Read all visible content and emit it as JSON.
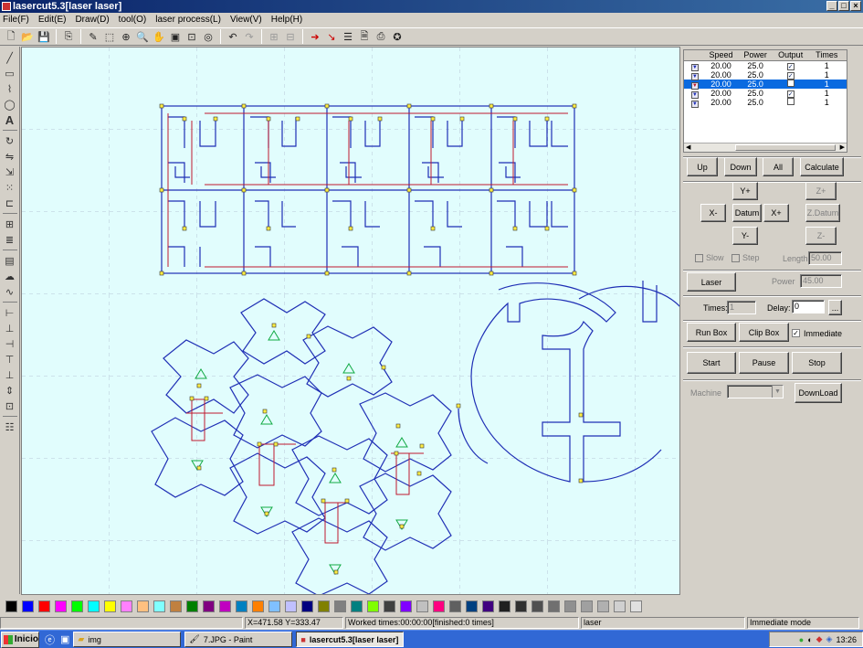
{
  "window": {
    "title": "lasercut5.3[laser laser]"
  },
  "menu": [
    "File(F)",
    "Edit(E)",
    "Draw(D)",
    "tool(O)",
    "laser process(L)",
    "View(V)",
    "Help(H)"
  ],
  "layers": {
    "headers": [
      "Speed",
      "Power",
      "Output",
      "Times"
    ],
    "rows": [
      {
        "speed": "20.00",
        "power": "25.0",
        "output": true,
        "times": "1",
        "color": "#1f2fb5",
        "selected": false
      },
      {
        "speed": "20.00",
        "power": "25.0",
        "output": true,
        "times": "1",
        "color": "#1f2fb5",
        "selected": false
      },
      {
        "speed": "20.00",
        "power": "25.0",
        "output": false,
        "times": "1",
        "color": "#c0192f",
        "selected": true
      },
      {
        "speed": "20.00",
        "power": "25.0",
        "output": true,
        "times": "1",
        "color": "#1f2fb5",
        "selected": false
      },
      {
        "speed": "20.00",
        "power": "25.0",
        "output": false,
        "times": "1",
        "color": "#1f2fb5",
        "selected": false
      }
    ]
  },
  "controls": {
    "up": "Up",
    "down": "Down",
    "all": "All",
    "calculate": "Calculate",
    "yplus": "Y+",
    "xminus": "X-",
    "datum": "Datum",
    "xplus": "X+",
    "yminus": "Y-",
    "zplus": "Z+",
    "zdatum": "Z.Datum",
    "zminus": "Z-",
    "slow": "Slow",
    "step": "Step",
    "length_label": "Length",
    "length_value": "50.00",
    "laser": "Laser",
    "power_label": "Power",
    "power_value": "45.00",
    "times_label": "Times:",
    "times_value": "1",
    "delay_label": "Delay:",
    "delay_value": "0",
    "delay_btn": "...",
    "runbox": "Run Box",
    "clipbox": "Clip Box",
    "immediate": "Immediate",
    "immediate_checked": true,
    "start": "Start",
    "pause": "Pause",
    "stop": "Stop",
    "machine_label": "Machine",
    "download": "DownLoad"
  },
  "palette": [
    "#000000",
    "#0000ff",
    "#ff0000",
    "#ff00ff",
    "#00ff00",
    "#00ffff",
    "#ffff00",
    "#ff80ff",
    "#ffc080",
    "#80ffff",
    "#c08040",
    "#008000",
    "#800080",
    "#c000c0",
    "#0080c0",
    "#ff8000",
    "#80c0ff",
    "#c0c0ff",
    "#000080",
    "#808000",
    "#808080",
    "#008080",
    "#80ff00",
    "#404040",
    "#8000ff",
    "#c0c0c0",
    "#ff0080",
    "#606060",
    "#004080",
    "#400080",
    "#202020",
    "#303030",
    "#505050",
    "#707070",
    "#909090",
    "#a0a0a0",
    "#b0b0b0",
    "#d0d0d0",
    "#e0e0e0"
  ],
  "status": {
    "coords": "X=471.58 Y=333.47",
    "worked": "Worked times:00:00:00[finished:0 times]",
    "device": "laser",
    "mode": "Immediate mode"
  },
  "taskbar": {
    "start": "Inicio",
    "tasks": [
      "img",
      "7.JPG - Paint",
      "lasercut5.3[laser laser]"
    ],
    "clock": "13:26"
  }
}
